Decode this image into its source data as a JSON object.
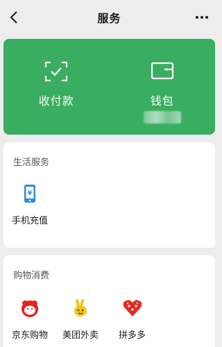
{
  "nav": {
    "title": "服务",
    "back_icon": "chevron-left-icon",
    "more_icon": "more-dots-icon"
  },
  "payment": {
    "bg_color": "#39ad60",
    "items": [
      {
        "label": "收付款",
        "icon": "scan-check-icon"
      },
      {
        "label": "钱包",
        "icon": "wallet-icon"
      }
    ]
  },
  "life": {
    "title": "生活服务",
    "items": [
      {
        "label": "手机充值",
        "icon": "phone-recharge-icon"
      }
    ]
  },
  "shopping": {
    "title": "购物消费",
    "items": [
      {
        "label": "京东购物",
        "icon": "jd-icon"
      },
      {
        "label": "美团外卖",
        "icon": "meituan-icon"
      },
      {
        "label": "拼多多",
        "icon": "pinduoduo-icon"
      }
    ]
  }
}
